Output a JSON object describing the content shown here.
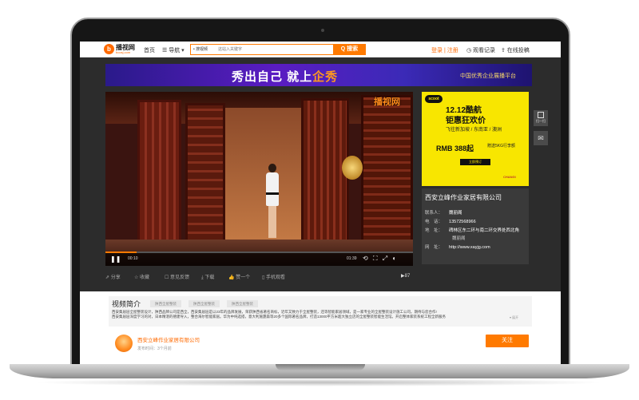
{
  "header": {
    "logo_mark": "b",
    "logo_text": "播视网",
    "logo_sub": "boosj.com",
    "nav_home": "首页",
    "nav_menu": "☰ 导航 ▾",
    "search_category": "• 搜视频",
    "search_placeholder": "这站入关键字",
    "search_button": "Q 搜索",
    "login": "登录 | 注册",
    "history": "◷ 观看记录",
    "upload": "⇪ 在线投稿"
  },
  "banner": {
    "slogan_a": "秀出自己  就上",
    "slogan_b": "企秀",
    "right_text": "中国优秀企业展播平台"
  },
  "video": {
    "watermark": "播视网",
    "time_current": "00:10",
    "time_total": "01:39",
    "progress": 0.1,
    "play_icon": "❚❚",
    "controls": "⟲ ⛶ ⤢ ◐"
  },
  "ad": {
    "brand_badge": "scoot",
    "title1": "12.12酷航",
    "title2": "钜惠狂欢价",
    "destinations": "飞往新加坡 / 东南亚 / 澳洲",
    "price": "RMB 388起",
    "extra": "赠送5KG行李额",
    "cta": "立即预订",
    "partner": "CHANGI"
  },
  "company": {
    "name": "西安立峰作业家居有限公司",
    "contact_label": "联系人：",
    "contact": "魏丽阁",
    "phone_label": "电　话：",
    "phone": "13572568966",
    "address_label": "地　址：",
    "address": "碑林区东二环与南二环交界处西北角",
    "address2": "魏丽阁",
    "site_label": "网　址：",
    "site": "http://www.xayjg.com"
  },
  "sidetools": {
    "qr_label": "扫一扫",
    "mail_icon": "✉"
  },
  "actions": {
    "share": "⇗ 分享",
    "fav": "☆ 收藏",
    "report": "☐ 意见反馈",
    "download": "⤓ 下载",
    "like": "👍 赞一个",
    "mobile": "▯ 手机观看",
    "views": "▶87"
  },
  "intro": {
    "title": "视频简介",
    "tags": [
      "陕西全屋整装",
      "陕西全屋整装",
      "陕西全屋整装"
    ],
    "line1": "西安集居层全屋整装设计，陕西品牌公司是西全，西安集居层是以23年的品牌发展，荣获陕西省著名商标，近年又致力于全屋整装，还等智能家居领域，是一家专业的全屋整装设计施工公司。期待与您合作!",
    "line2": "西安集居层深度学习的对，日本精湛的德建导入，整合海尔智能家居。华为中纯选搭，意大利施霆森等20多个国际著名品牌，打造13000平方米超大独立店的全屋整装智能生活馆。开启整体家装系统工程全新服务",
    "more": "▾ 展开"
  },
  "uploader": {
    "name": "西安立峰作业家居有限公司",
    "time": "发布时间：3个月前",
    "follow": "关注"
  }
}
